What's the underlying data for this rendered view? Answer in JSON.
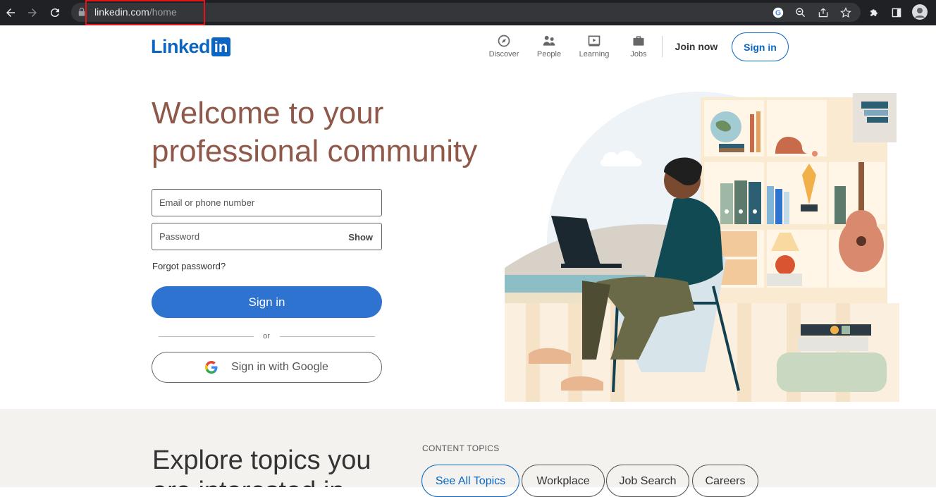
{
  "browser": {
    "url_domain": "linkedin.com",
    "url_path": "/home"
  },
  "header": {
    "logo_text": "Linked",
    "logo_box": "in",
    "nav": [
      {
        "label": "Discover",
        "icon": "compass-icon"
      },
      {
        "label": "People",
        "icon": "people-icon"
      },
      {
        "label": "Learning",
        "icon": "learning-icon"
      },
      {
        "label": "Jobs",
        "icon": "briefcase-icon"
      }
    ],
    "join_now": "Join now",
    "sign_in": "Sign in"
  },
  "hero": {
    "title_line1": "Welcome to your",
    "title_line2": "professional community",
    "email_placeholder": "Email or phone number",
    "password_placeholder": "Password",
    "show_label": "Show",
    "forgot_password": "Forgot password?",
    "sign_in_button": "Sign in",
    "or_text": "or",
    "google_button": "Sign in with Google"
  },
  "explore": {
    "heading_line1": "Explore topics you",
    "heading_line2": "are interested in",
    "content_topics_label": "CONTENT TOPICS",
    "topics": [
      "See All Topics",
      "Workplace",
      "Job Search",
      "Careers"
    ]
  },
  "colors": {
    "brand": "#0a66c2",
    "hero_title": "#8f5849",
    "primary_button": "#2f73d0",
    "band_bg": "#f3f2ef"
  }
}
